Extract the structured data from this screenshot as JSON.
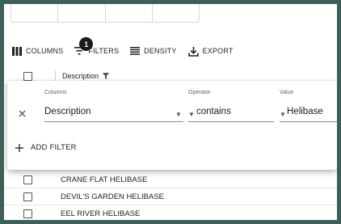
{
  "toolbar": {
    "columns_label": "COLUMNS",
    "filters_label": "FILTERS",
    "filters_count": "1",
    "density_label": "DENSITY",
    "export_label": "EXPORT"
  },
  "header": {
    "column_label": "Description"
  },
  "filter_panel": {
    "columns_label": "Columns",
    "operator_label": "Operator",
    "value_label": "Value",
    "column_value": "Description",
    "operator_value": "contains",
    "value_value": "Helibase",
    "add_filter_label": "ADD FILTER"
  },
  "rows": [
    "CRANE FLAT HELIBASE",
    "DEVIL'S GARDEN HELIBASE",
    "EEL RIVER HELIBASE"
  ],
  "colors": {
    "frame": "#3f5f5a",
    "badge": "#1c1c1c"
  }
}
